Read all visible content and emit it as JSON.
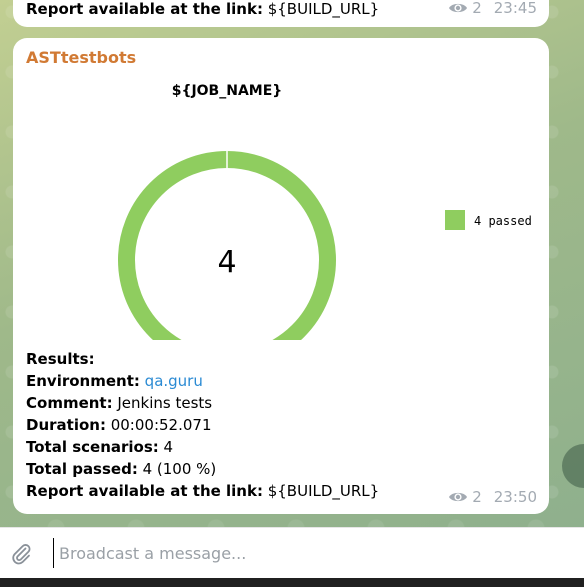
{
  "colors": {
    "sender": "#d17a34",
    "link": "#2a8ad3",
    "chart_passed": "#8fcd5f",
    "meta": "#a3aab2"
  },
  "prev_message": {
    "label": "Report available at the link:",
    "value": " ${BUILD_URL}",
    "views": "2",
    "time": "23:45"
  },
  "message": {
    "sender": "ASTtestbots",
    "views": "2",
    "time": "23:50",
    "results": {
      "heading": "Results:",
      "environment_label": "Environment:",
      "environment_value": "qa.guru",
      "comment_label": "Comment:",
      "comment_value": " Jenkins tests",
      "duration_label": "Duration:",
      "duration_value": " 00:00:52.071",
      "scenarios_label": "Total scenarios:",
      "scenarios_value": " 4",
      "passed_label": "Total passed:",
      "passed_value": " 4 (100 %)",
      "report_label": "Report available at the link:",
      "report_value": " ${BUILD_URL}"
    }
  },
  "chart_data": {
    "type": "pie",
    "title": "${JOB_NAME}",
    "center_label": "4",
    "slices": [
      {
        "label": "4 passed",
        "value": 4,
        "color": "#8fcd5f"
      }
    ],
    "legend_placement": "right"
  },
  "composer": {
    "placeholder": "Broadcast a message..."
  },
  "icons": {
    "views": "eye-icon",
    "attach": "paperclip-icon"
  }
}
